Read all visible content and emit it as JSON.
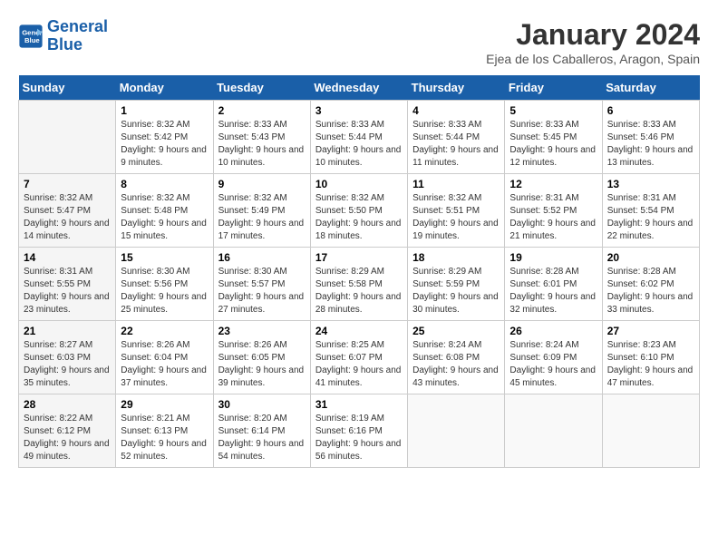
{
  "header": {
    "logo_line1": "General",
    "logo_line2": "Blue",
    "month": "January 2024",
    "location": "Ejea de los Caballeros, Aragon, Spain"
  },
  "days_of_week": [
    "Sunday",
    "Monday",
    "Tuesday",
    "Wednesday",
    "Thursday",
    "Friday",
    "Saturday"
  ],
  "weeks": [
    [
      {
        "day": "",
        "sunrise": "",
        "sunset": "",
        "daylight": ""
      },
      {
        "day": "1",
        "sunrise": "Sunrise: 8:32 AM",
        "sunset": "Sunset: 5:42 PM",
        "daylight": "Daylight: 9 hours and 9 minutes."
      },
      {
        "day": "2",
        "sunrise": "Sunrise: 8:33 AM",
        "sunset": "Sunset: 5:43 PM",
        "daylight": "Daylight: 9 hours and 10 minutes."
      },
      {
        "day": "3",
        "sunrise": "Sunrise: 8:33 AM",
        "sunset": "Sunset: 5:44 PM",
        "daylight": "Daylight: 9 hours and 10 minutes."
      },
      {
        "day": "4",
        "sunrise": "Sunrise: 8:33 AM",
        "sunset": "Sunset: 5:44 PM",
        "daylight": "Daylight: 9 hours and 11 minutes."
      },
      {
        "day": "5",
        "sunrise": "Sunrise: 8:33 AM",
        "sunset": "Sunset: 5:45 PM",
        "daylight": "Daylight: 9 hours and 12 minutes."
      },
      {
        "day": "6",
        "sunrise": "Sunrise: 8:33 AM",
        "sunset": "Sunset: 5:46 PM",
        "daylight": "Daylight: 9 hours and 13 minutes."
      }
    ],
    [
      {
        "day": "7",
        "sunrise": "Sunrise: 8:32 AM",
        "sunset": "Sunset: 5:47 PM",
        "daylight": "Daylight: 9 hours and 14 minutes."
      },
      {
        "day": "8",
        "sunrise": "Sunrise: 8:32 AM",
        "sunset": "Sunset: 5:48 PM",
        "daylight": "Daylight: 9 hours and 15 minutes."
      },
      {
        "day": "9",
        "sunrise": "Sunrise: 8:32 AM",
        "sunset": "Sunset: 5:49 PM",
        "daylight": "Daylight: 9 hours and 17 minutes."
      },
      {
        "day": "10",
        "sunrise": "Sunrise: 8:32 AM",
        "sunset": "Sunset: 5:50 PM",
        "daylight": "Daylight: 9 hours and 18 minutes."
      },
      {
        "day": "11",
        "sunrise": "Sunrise: 8:32 AM",
        "sunset": "Sunset: 5:51 PM",
        "daylight": "Daylight: 9 hours and 19 minutes."
      },
      {
        "day": "12",
        "sunrise": "Sunrise: 8:31 AM",
        "sunset": "Sunset: 5:52 PM",
        "daylight": "Daylight: 9 hours and 21 minutes."
      },
      {
        "day": "13",
        "sunrise": "Sunrise: 8:31 AM",
        "sunset": "Sunset: 5:54 PM",
        "daylight": "Daylight: 9 hours and 22 minutes."
      }
    ],
    [
      {
        "day": "14",
        "sunrise": "Sunrise: 8:31 AM",
        "sunset": "Sunset: 5:55 PM",
        "daylight": "Daylight: 9 hours and 23 minutes."
      },
      {
        "day": "15",
        "sunrise": "Sunrise: 8:30 AM",
        "sunset": "Sunset: 5:56 PM",
        "daylight": "Daylight: 9 hours and 25 minutes."
      },
      {
        "day": "16",
        "sunrise": "Sunrise: 8:30 AM",
        "sunset": "Sunset: 5:57 PM",
        "daylight": "Daylight: 9 hours and 27 minutes."
      },
      {
        "day": "17",
        "sunrise": "Sunrise: 8:29 AM",
        "sunset": "Sunset: 5:58 PM",
        "daylight": "Daylight: 9 hours and 28 minutes."
      },
      {
        "day": "18",
        "sunrise": "Sunrise: 8:29 AM",
        "sunset": "Sunset: 5:59 PM",
        "daylight": "Daylight: 9 hours and 30 minutes."
      },
      {
        "day": "19",
        "sunrise": "Sunrise: 8:28 AM",
        "sunset": "Sunset: 6:01 PM",
        "daylight": "Daylight: 9 hours and 32 minutes."
      },
      {
        "day": "20",
        "sunrise": "Sunrise: 8:28 AM",
        "sunset": "Sunset: 6:02 PM",
        "daylight": "Daylight: 9 hours and 33 minutes."
      }
    ],
    [
      {
        "day": "21",
        "sunrise": "Sunrise: 8:27 AM",
        "sunset": "Sunset: 6:03 PM",
        "daylight": "Daylight: 9 hours and 35 minutes."
      },
      {
        "day": "22",
        "sunrise": "Sunrise: 8:26 AM",
        "sunset": "Sunset: 6:04 PM",
        "daylight": "Daylight: 9 hours and 37 minutes."
      },
      {
        "day": "23",
        "sunrise": "Sunrise: 8:26 AM",
        "sunset": "Sunset: 6:05 PM",
        "daylight": "Daylight: 9 hours and 39 minutes."
      },
      {
        "day": "24",
        "sunrise": "Sunrise: 8:25 AM",
        "sunset": "Sunset: 6:07 PM",
        "daylight": "Daylight: 9 hours and 41 minutes."
      },
      {
        "day": "25",
        "sunrise": "Sunrise: 8:24 AM",
        "sunset": "Sunset: 6:08 PM",
        "daylight": "Daylight: 9 hours and 43 minutes."
      },
      {
        "day": "26",
        "sunrise": "Sunrise: 8:24 AM",
        "sunset": "Sunset: 6:09 PM",
        "daylight": "Daylight: 9 hours and 45 minutes."
      },
      {
        "day": "27",
        "sunrise": "Sunrise: 8:23 AM",
        "sunset": "Sunset: 6:10 PM",
        "daylight": "Daylight: 9 hours and 47 minutes."
      }
    ],
    [
      {
        "day": "28",
        "sunrise": "Sunrise: 8:22 AM",
        "sunset": "Sunset: 6:12 PM",
        "daylight": "Daylight: 9 hours and 49 minutes."
      },
      {
        "day": "29",
        "sunrise": "Sunrise: 8:21 AM",
        "sunset": "Sunset: 6:13 PM",
        "daylight": "Daylight: 9 hours and 52 minutes."
      },
      {
        "day": "30",
        "sunrise": "Sunrise: 8:20 AM",
        "sunset": "Sunset: 6:14 PM",
        "daylight": "Daylight: 9 hours and 54 minutes."
      },
      {
        "day": "31",
        "sunrise": "Sunrise: 8:19 AM",
        "sunset": "Sunset: 6:16 PM",
        "daylight": "Daylight: 9 hours and 56 minutes."
      },
      {
        "day": "",
        "sunrise": "",
        "sunset": "",
        "daylight": ""
      },
      {
        "day": "",
        "sunrise": "",
        "sunset": "",
        "daylight": ""
      },
      {
        "day": "",
        "sunrise": "",
        "sunset": "",
        "daylight": ""
      }
    ]
  ]
}
